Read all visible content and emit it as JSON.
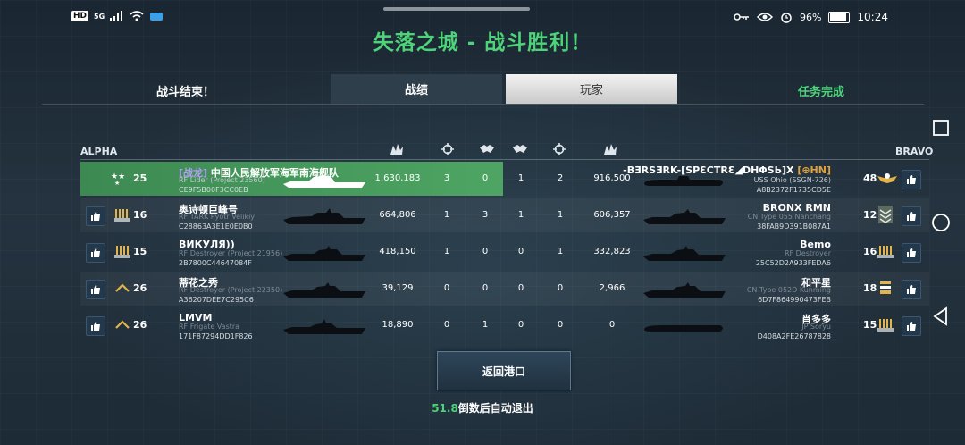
{
  "status_bar": {
    "left": {
      "hd": "HD",
      "network": "5G"
    },
    "right": {
      "battery": "96%",
      "time": "10:24"
    }
  },
  "title": "失落之城 - 战斗胜利！",
  "tabs": {
    "left_label": "战斗结束！",
    "stats": "战绩",
    "players": "玩家",
    "right_label": "任务完成"
  },
  "teams": {
    "alpha": "ALPHA",
    "bravo": "BRAVO"
  },
  "column_icons": [
    "damage-icon",
    "target-icon",
    "handshake-icon",
    "handshake-icon",
    "target-icon",
    "damage-icon"
  ],
  "alpha_rows": [
    {
      "rank": "25",
      "tag": "[战龙]",
      "name": "中国人民解放军海军南海舰队",
      "ship": "RF Lider (Project 23560)",
      "id": "CE9F5B00F3CC0EB",
      "damage": "1,630,183",
      "kills": "3",
      "assists": "0",
      "highlight": true
    },
    {
      "rank": "16",
      "tag": "",
      "name": "奥诗顿巨峰号",
      "ship": "RF TARK Pyotr Velikiy",
      "id": "C28863A3E1E0E0B0",
      "damage": "664,806",
      "kills": "1",
      "assists": "3"
    },
    {
      "rank": "15",
      "tag": "",
      "name": "ВИКУЛЯ))",
      "ship": "RF Destroyer (Project 21956)",
      "id": "2B7800C44647084F",
      "damage": "418,150",
      "kills": "1",
      "assists": "0"
    },
    {
      "rank": "26",
      "tag": "",
      "name": "蒂花之秀",
      "ship": "RF Destroyer (Project 22350)",
      "id": "A36207DEE7C295C6",
      "damage": "39,129",
      "kills": "0",
      "assists": "0"
    },
    {
      "rank": "26",
      "tag": "",
      "name": "LMVM",
      "ship": "RF Frigate Vastra",
      "id": "171F87294DD1F826",
      "damage": "18,890",
      "kills": "0",
      "assists": "1"
    }
  ],
  "bravo_rows": [
    {
      "rank": "48",
      "name": "-BƎRSƎRK-[SPƐCTRƐ◢DHΦSЬ]X",
      "tag": "[⊕HN]",
      "ship": "USS Ohio (SSGN-726)",
      "id": "A8B2372F1735CD5E",
      "damage": "916,500",
      "kills": "2",
      "assists": "1"
    },
    {
      "rank": "12",
      "name": "BRONX RMN",
      "tag": "",
      "ship": "CN Type 055 Nanchang",
      "id": "38FAB9D391B087A1",
      "damage": "606,357",
      "kills": "1",
      "assists": "1"
    },
    {
      "rank": "16",
      "name": "Bemo",
      "tag": "",
      "ship": "RF Destroyer",
      "id": "25C52D2A933FEDA6",
      "damage": "332,823",
      "kills": "1",
      "assists": "0"
    },
    {
      "rank": "18",
      "name": "和平星",
      "tag": "",
      "ship": "CN Type 052D Kunming",
      "id": "6D7F864990473FEB",
      "damage": "2,966",
      "kills": "0",
      "assists": "0"
    },
    {
      "rank": "15",
      "name": "肖多多",
      "tag": "",
      "ship": "JP Soryu",
      "id": "D408A2FE26787828",
      "damage": "0",
      "kills": "0",
      "assists": "0"
    }
  ],
  "return_button": "返回港口",
  "countdown": {
    "seconds": "51.8",
    "text": "倒数后自动退出"
  },
  "colors": {
    "accent_green": "#4ed37a",
    "highlight_row": "#4ea563",
    "clan_tag": "#b39cf5"
  }
}
